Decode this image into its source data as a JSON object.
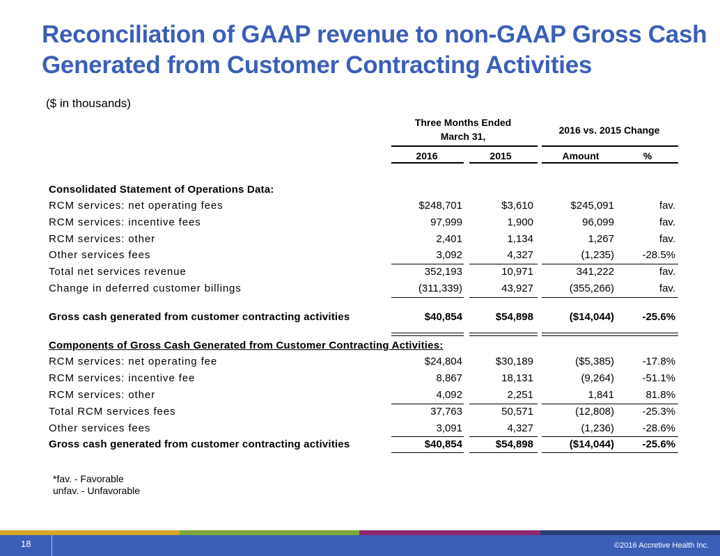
{
  "title": "Reconciliation of GAAP revenue to non-GAAP Gross Cash Generated from Customer Contracting Activities",
  "subtitle": "($ in thousands)",
  "header": {
    "group1": "Three Months Ended March 31,",
    "group2": "2016 vs. 2015 Change",
    "cols": [
      "2016",
      "2015",
      "Amount",
      "%"
    ]
  },
  "sections": {
    "ops": "Consolidated Statement of Operations Data:",
    "components": "Components of Gross Cash Generated from Customer Contracting Activities:"
  },
  "rows": [
    {
      "label": "RCM services: net operating fees",
      "v2016": "$248,701",
      "v2015": "$3,610",
      "amount": "$245,091",
      "pct": "fav."
    },
    {
      "label": "RCM services: incentive fees",
      "v2016": "97,999",
      "v2015": "1,900",
      "amount": "96,099",
      "pct": "fav."
    },
    {
      "label": "RCM services: other",
      "v2016": "2,401",
      "v2015": "1,134",
      "amount": "1,267",
      "pct": "fav."
    },
    {
      "label": "Other services fees",
      "v2016": "3,092",
      "v2015": "4,327",
      "amount": "(1,235)",
      "pct": "-28.5%"
    },
    {
      "label": "Total net services revenue",
      "v2016": "352,193",
      "v2015": "10,971",
      "amount": "341,222",
      "pct": "fav."
    },
    {
      "label": "Change in deferred customer billings",
      "v2016": "(311,339)",
      "v2015": "43,927",
      "amount": "(355,266)",
      "pct": "fav."
    },
    {
      "label": "Gross cash generated from customer contracting activities",
      "v2016": "$40,854",
      "v2015": "$54,898",
      "amount": "($14,044)",
      "pct": "-25.6%"
    },
    {
      "label": "RCM services: net operating fee",
      "v2016": "$24,804",
      "v2015": "$30,189",
      "amount": "($5,385)",
      "pct": "-17.8%"
    },
    {
      "label": "RCM services: incentive fee",
      "v2016": "8,867",
      "v2015": "18,131",
      "amount": "(9,264)",
      "pct": "-51.1%"
    },
    {
      "label": "RCM services: other",
      "v2016": "4,092",
      "v2015": "2,251",
      "amount": "1,841",
      "pct": "81.8%"
    },
    {
      "label": "Total RCM services fees",
      "v2016": "37,763",
      "v2015": "50,571",
      "amount": "(12,808)",
      "pct": "-25.3%"
    },
    {
      "label": "Other services fees",
      "v2016": "3,091",
      "v2015": "4,327",
      "amount": "(1,236)",
      "pct": "-28.6%"
    },
    {
      "label": "Gross cash generated from customer contracting activities",
      "v2016": "$40,854",
      "v2015": "$54,898",
      "amount": "($14,044)",
      "pct": "-25.6%"
    }
  ],
  "footnote": {
    "line1": "*fav. - Favorable",
    "line2": "unfav. - Unfavorable"
  },
  "footer": {
    "page_number": "18",
    "copyright": "©2016 Accretive Health Inc."
  },
  "colors": {
    "title": "#3b5fb7",
    "footer_band": "#3b5fb7",
    "bar_gold": "#d4a92a",
    "bar_green": "#7fa83a",
    "bar_purple": "#8e2a6e",
    "bar_navy": "#2a3f78"
  }
}
